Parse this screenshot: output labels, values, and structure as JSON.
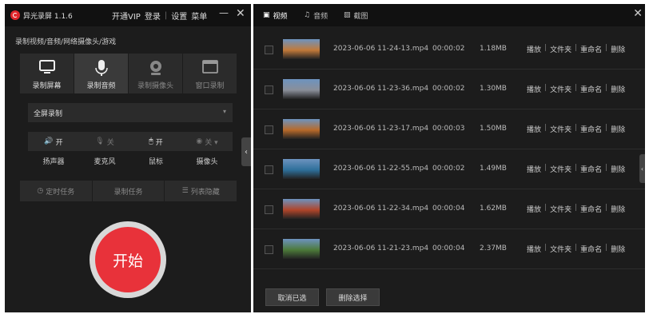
{
  "app": {
    "title": "异光录屏 1.1.6",
    "menu": [
      "开通VIP",
      "登录",
      "设置",
      "菜单"
    ],
    "min": "—",
    "close": "✕"
  },
  "subtitle": "录制视频/音频/网络摄像头/游戏",
  "modes": [
    {
      "label": "录制屏幕",
      "icon": "monitor-icon"
    },
    {
      "label": "录制音频",
      "icon": "microphone-icon"
    },
    {
      "label": "录制摄像头",
      "icon": "webcam-icon"
    },
    {
      "label": "窗口录制",
      "icon": "window-icon"
    }
  ],
  "select": {
    "value": "全屏录制",
    "arrow": "▾"
  },
  "toggles": [
    {
      "icon": "speaker-icon",
      "glyph": "🔊",
      "state": "开"
    },
    {
      "icon": "microphone-off-icon",
      "glyph": "🎙",
      "state": "关"
    },
    {
      "icon": "mouse-icon",
      "glyph": "🖱",
      "state": "开"
    },
    {
      "icon": "camera-off-icon",
      "glyph": "◉",
      "state": "关 ▾"
    }
  ],
  "toggle_labels": [
    "扬声器",
    "麦克风",
    "鼠标",
    "摄像头"
  ],
  "task_buttons": [
    {
      "label": "定时任务",
      "glyph": "◷"
    },
    {
      "label": "录制任务",
      "glyph": ""
    },
    {
      "label": "列表隐藏",
      "glyph": "☰"
    }
  ],
  "start_label": "开始",
  "collapse_glyph": "‹",
  "right_tabs": [
    {
      "label": "视频",
      "icon": "video-icon",
      "glyph": "▣"
    },
    {
      "label": "音频",
      "icon": "music-icon",
      "glyph": "♫"
    },
    {
      "label": "截图",
      "icon": "image-icon",
      "glyph": "▨"
    }
  ],
  "right_close": "✕",
  "recordings": [
    {
      "name": "2023-06-06 11-24-13.mp4",
      "duration": "00:00:02",
      "size": "1.18MB",
      "thumb": "#c27a3a"
    },
    {
      "name": "2023-06-06 11-23-36.mp4",
      "duration": "00:00:02",
      "size": "1.30MB",
      "thumb": "#8a8f99"
    },
    {
      "name": "2023-06-06 11-23-17.mp4",
      "duration": "00:00:03",
      "size": "1.50MB",
      "thumb": "#b86a2a"
    },
    {
      "name": "2023-06-06 11-22-55.mp4",
      "duration": "00:00:02",
      "size": "1.49MB",
      "thumb": "#2e6f9a"
    },
    {
      "name": "2023-06-06 11-22-34.mp4",
      "duration": "00:00:04",
      "size": "1.62MB",
      "thumb": "#b0452a"
    },
    {
      "name": "2023-06-06 11-21-23.mp4",
      "duration": "00:00:04",
      "size": "2.37MB",
      "thumb": "#4c7a3a"
    }
  ],
  "row_actions": [
    "播放",
    "文件夹",
    "重命名",
    "删除"
  ],
  "bottom_buttons": [
    "取消已选",
    "删除选择"
  ]
}
